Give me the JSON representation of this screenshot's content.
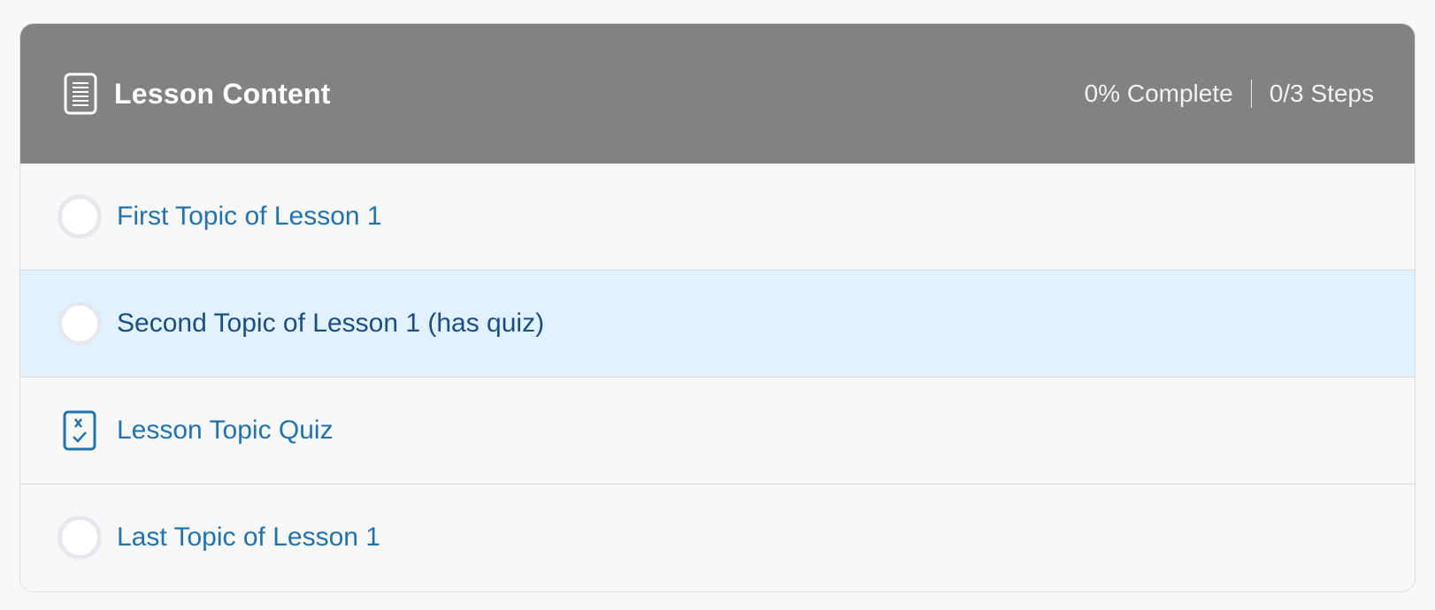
{
  "header": {
    "icon": "document-icon",
    "title": "Lesson Content",
    "progress_text": "0% Complete",
    "steps_text": "0/3 Steps",
    "background_color": "#828282"
  },
  "items": [
    {
      "label": "First Topic of Lesson 1",
      "type": "topic",
      "icon": "incomplete-circle-icon",
      "highlighted": false
    },
    {
      "label": "Second Topic of Lesson 1 (has quiz)",
      "type": "topic",
      "icon": "incomplete-circle-icon",
      "highlighted": true
    },
    {
      "label": "Lesson Topic Quiz",
      "type": "quiz",
      "icon": "quiz-icon",
      "highlighted": false
    },
    {
      "label": "Last Topic of Lesson 1",
      "type": "topic",
      "icon": "incomplete-circle-icon",
      "highlighted": false
    }
  ],
  "colors": {
    "link": "#2073b3",
    "highlight_background": "#e1f1fd",
    "highlight_text": "#1b4e86"
  }
}
